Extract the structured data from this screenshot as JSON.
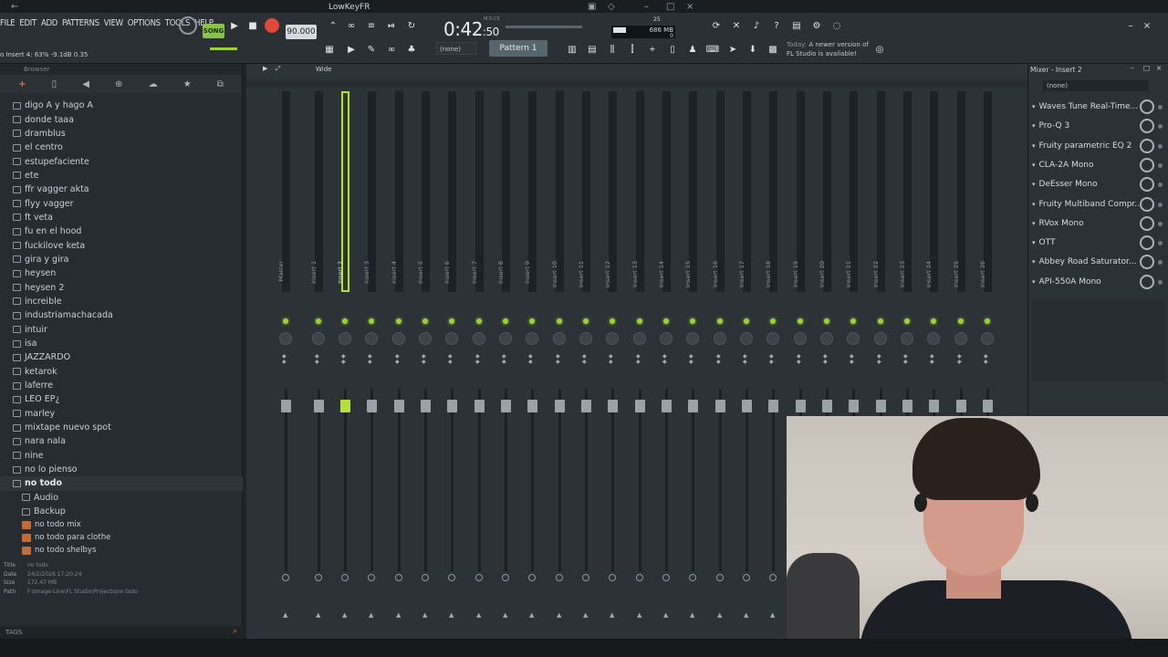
{
  "window": {
    "title": "LowKeyFR"
  },
  "menu": [
    "FILE",
    "EDIT",
    "ADD",
    "PATTERNS",
    "VIEW",
    "OPTIONS",
    "TOOLS",
    "HELP"
  ],
  "transport": {
    "mode": "SONG",
    "tempo": "90.000",
    "time_main": "0:42",
    "time_sub": ":50",
    "time_label": "M:S:CS"
  },
  "cpu": {
    "voices": "25",
    "memory": "686 MB",
    "cpu_val": "0"
  },
  "hint": "o Insert 4: 63%  -9.1dB  0.35",
  "pattern": {
    "label": "Pattern 1",
    "none": "(none)"
  },
  "news": {
    "line1": "Today:",
    "line2": "A newer version of",
    "line3": "FL Studio is available!"
  },
  "browser": {
    "header": "Browser",
    "folders": [
      "digo A y hago A",
      "donde taaa",
      "dramblus",
      "el centro",
      "estupefaciente",
      "ete",
      "ffr vagger akta",
      "flyy vagger",
      "ft veta",
      "fu en el hood",
      "fuckilove keta",
      "gira y gira",
      "heysen",
      "heysen 2",
      "increible",
      "industriamachacada",
      "intuir",
      "isa",
      "JAZZARDO",
      "ketarok",
      "laferre",
      "LEO EP¿",
      "marley",
      "mixtape nuevo spot",
      "nara nala",
      "nine",
      "no lo pienso"
    ],
    "open_folder": "no todo",
    "subfolders": [
      "Audio",
      "Backup"
    ],
    "files": [
      "no todo mix",
      "no todo para clothe",
      "no todo shelbys"
    ],
    "info": {
      "title_k": "Title",
      "title_v": "no todo",
      "date_k": "Date",
      "date_v": "24/2/2026 17:20:24",
      "size_k": "Size",
      "size_v": "172.47 MB",
      "path_k": "Path",
      "path_v": "F:\\Image-Line\\FL Studio\\Projects\\no todo"
    },
    "tags_label": "TAGS"
  },
  "mixer": {
    "title": "Mixer - Insert 2",
    "view": "Wide",
    "strips": [
      "Master",
      "Insert 1",
      "Insert 2",
      "Insert 3",
      "Insert 4",
      "Insert 5",
      "Insert 6",
      "Insert 7",
      "Insert 8",
      "Insert 9",
      "Insert 10",
      "Insert 11",
      "Insert 12",
      "Insert 13",
      "Insert 14",
      "Insert 15",
      "Insert 16",
      "Insert 17",
      "Insert 18",
      "Insert 19",
      "Insert 20",
      "Insert 21",
      "Insert 22",
      "Insert 23",
      "Insert 24",
      "Insert 25",
      "Insert 26"
    ],
    "selected": "Insert 2"
  },
  "insert_panel": {
    "preset": "(none)",
    "slots": [
      "Waves Tune Real-Time...",
      "Pro-Q 3",
      "Fruity parametric EQ 2",
      "CLA-2A Mono",
      "DeEsser Mono",
      "Fruity Multiband Compr...",
      "RVox Mono",
      "OTT",
      "Abbey Road Saturator...",
      "API-550A Mono"
    ]
  },
  "colors": {
    "accent": "#b5e03a",
    "led": "#9bd23a",
    "record": "#e0483a"
  }
}
